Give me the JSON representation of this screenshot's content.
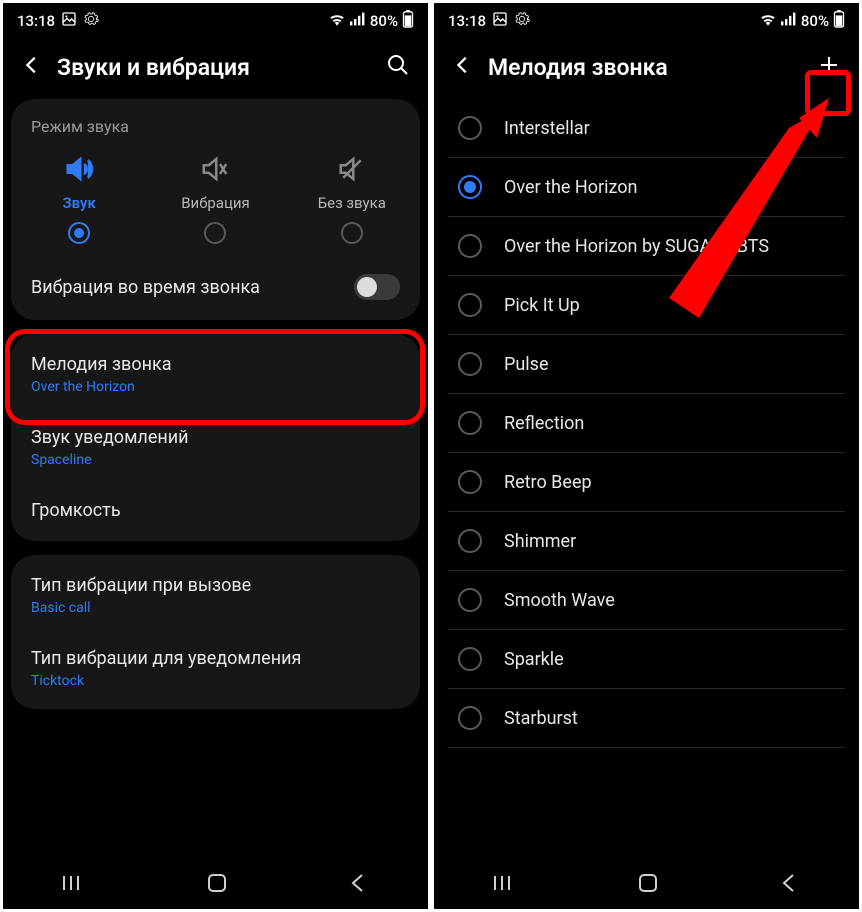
{
  "status": {
    "time": "13:18",
    "battery": "80%"
  },
  "left": {
    "title": "Звуки и вибрация",
    "sound_mode_header": "Режим звука",
    "modes": {
      "sound": "Звук",
      "vibrate": "Вибрация",
      "mute": "Без звука"
    },
    "vibrate_while_ringing": "Вибрация во время звонка",
    "ringtone": {
      "title": "Мелодия звонка",
      "value": "Over the Horizon"
    },
    "notification": {
      "title": "Звук уведомлений",
      "value": "Spaceline"
    },
    "volume": "Громкость",
    "vib_call": {
      "title": "Тип вибрации при вызове",
      "value": "Basic call"
    },
    "vib_notif": {
      "title": "Тип вибрации для уведомления",
      "value": "Ticktock"
    }
  },
  "right": {
    "title": "Мелодия звонка",
    "items": [
      {
        "label": "Interstellar",
        "selected": false
      },
      {
        "label": "Over the Horizon",
        "selected": true
      },
      {
        "label": "Over the Horizon by SUGA of BTS",
        "selected": false
      },
      {
        "label": "Pick It Up",
        "selected": false
      },
      {
        "label": "Pulse",
        "selected": false
      },
      {
        "label": "Reflection",
        "selected": false
      },
      {
        "label": "Retro Beep",
        "selected": false
      },
      {
        "label": "Shimmer",
        "selected": false
      },
      {
        "label": "Smooth Wave",
        "selected": false
      },
      {
        "label": "Sparkle",
        "selected": false
      },
      {
        "label": "Starburst",
        "selected": false
      }
    ]
  }
}
